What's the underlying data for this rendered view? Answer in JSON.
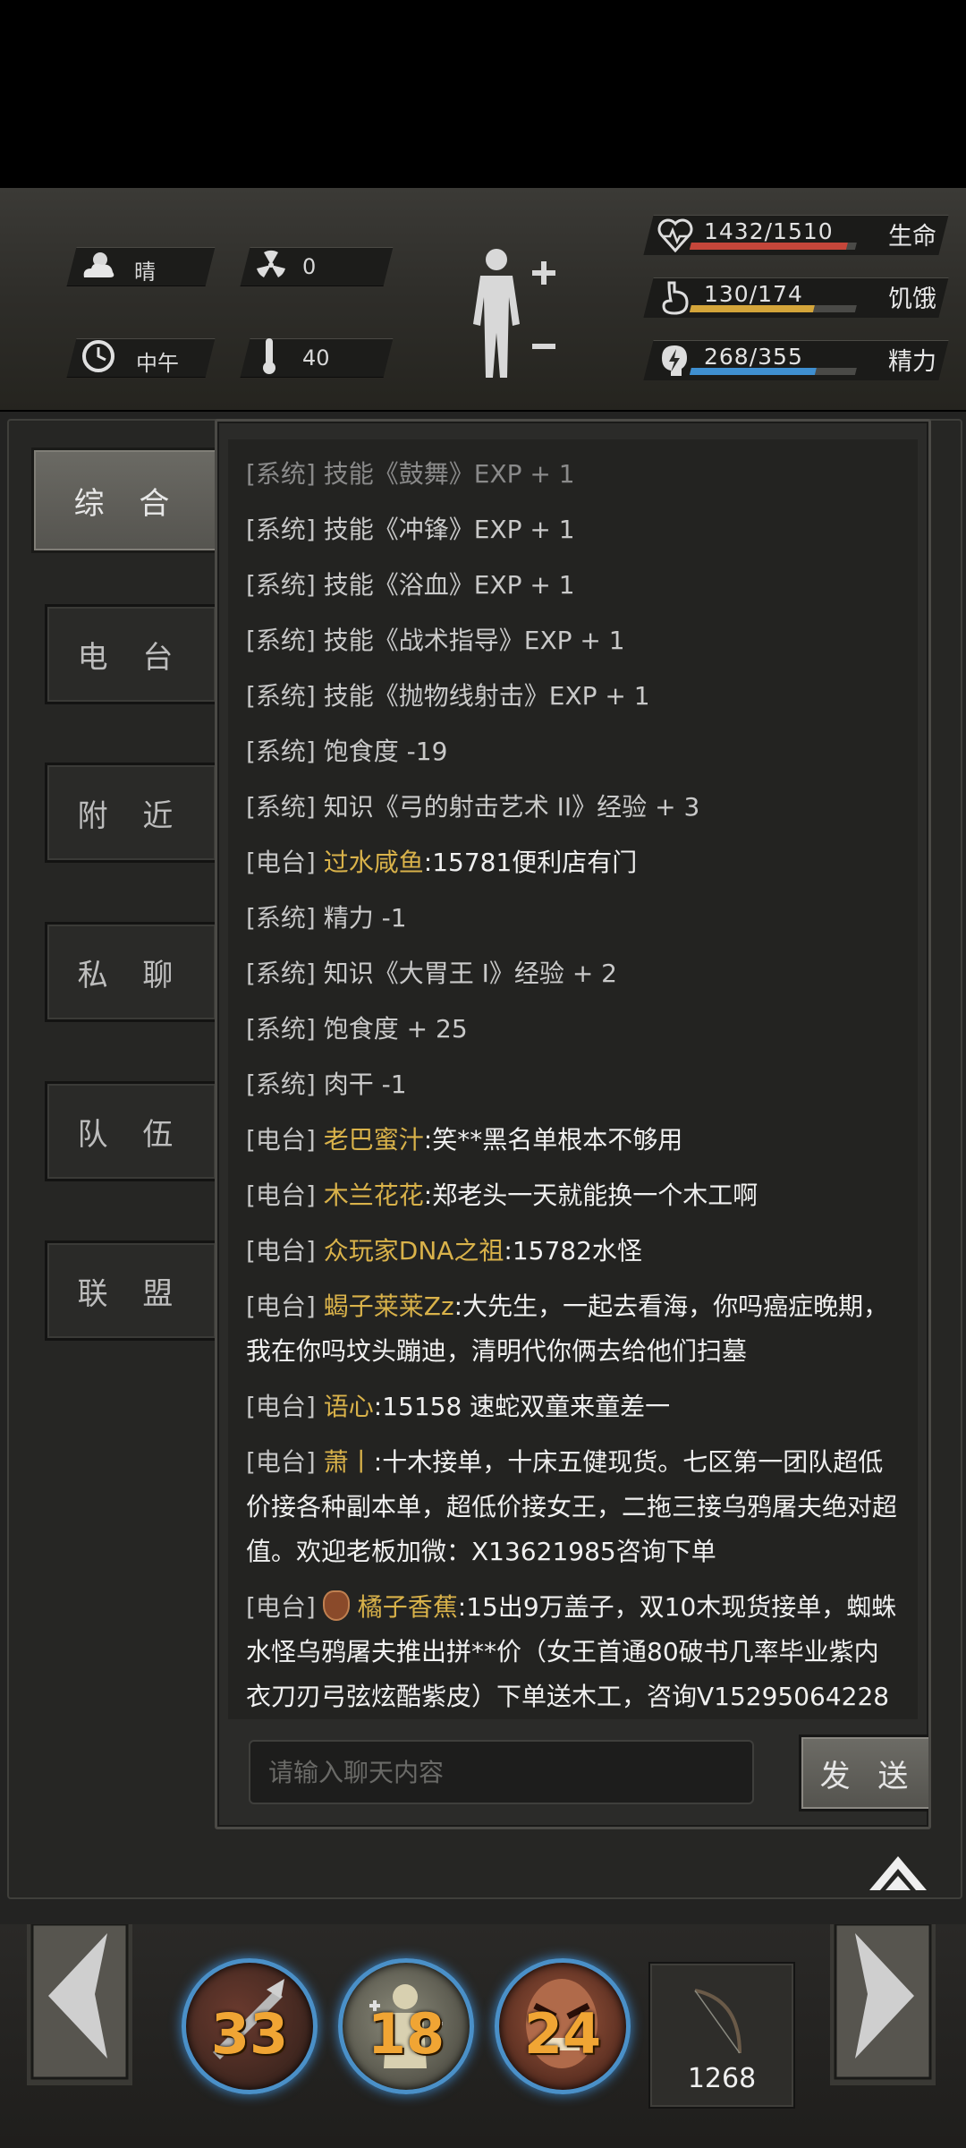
{
  "status": {
    "weather": "晴",
    "radiation": "0",
    "time_of_day": "中午",
    "temperature": "40",
    "health": {
      "value": "1432/1510",
      "label": "生命",
      "fraction": 0.948,
      "color": "#c5463a"
    },
    "hunger": {
      "value": "130/174",
      "label": "饥饿",
      "fraction": 0.747,
      "color": "#d4a53a"
    },
    "energy": {
      "value": "268/355",
      "label": "精力",
      "fraction": 0.755,
      "color": "#3f8fd0"
    }
  },
  "tabs": [
    "综 合",
    "电 台",
    "附 近",
    "私 聊",
    "队 伍",
    "联 盟"
  ],
  "chat": {
    "truncated_top": "[系统] 技能《鼓舞》EXP + 1",
    "lines": [
      {
        "ch": "[系统]",
        "name": "",
        "msg": " 技能《冲锋》EXP + 1"
      },
      {
        "ch": "[系统]",
        "name": "",
        "msg": " 技能《浴血》EXP + 1"
      },
      {
        "ch": "[系统]",
        "name": "",
        "msg": " 技能《战术指导》EXP + 1"
      },
      {
        "ch": "[系统]",
        "name": "",
        "msg": " 技能《抛物线射击》EXP + 1"
      },
      {
        "ch": "[系统]",
        "name": "",
        "msg": " 饱食度 -19"
      },
      {
        "ch": "[系统]",
        "name": "",
        "msg": " 知识《弓的射击艺术 II》经验 + 3"
      },
      {
        "ch": "[电台]",
        "name": " 过水咸鱼",
        "msg": ":15781便利店有门"
      },
      {
        "ch": "[系统]",
        "name": "",
        "msg": " 精力 -1"
      },
      {
        "ch": "[系统]",
        "name": "",
        "msg": " 知识《大胃王 I》经验 + 2"
      },
      {
        "ch": "[系统]",
        "name": "",
        "msg": " 饱食度 + 25"
      },
      {
        "ch": "[系统]",
        "name": "",
        "msg": " 肉干 -1"
      },
      {
        "ch": "[电台]",
        "name": " 老巴蜜汁",
        "msg": ":笑**黑名单根本不够用"
      },
      {
        "ch": "[电台]",
        "name": " 木兰花花",
        "msg": ":郑老头一天就能换一个木工啊"
      },
      {
        "ch": "[电台]",
        "name": " 众玩家DNA之祖",
        "msg": ":15782水怪"
      },
      {
        "ch": "[电台]",
        "name": " 蝎子莱莱Zz",
        "msg": ":大先生，一起去看海，你吗癌症晚期，我在你吗坟头蹦迪，清明代你俩去给他们扫墓"
      },
      {
        "ch": "[电台]",
        "name": " 语心",
        "msg": ":15158 速蛇双童来童差一"
      },
      {
        "ch": "[电台]",
        "name": " 萧丨",
        "msg": ":十木接单，十床五健现货。七区第一团队超低价接各种副本单，超低价接女王，二拖三接乌鸦屠夫绝对超值。欢迎老板加微：X13621985咨询下单"
      },
      {
        "ch": "[电台]",
        "name": " 橘子香蕉",
        "msg": ":15出9万盖子，双10木现货接单，蜘蛛水怪乌鸦屠夫推出拼**价（女王首通80破书几率毕业紫内衣刀刃弓弦炫酷紫皮）下单送木工，咨询V15295064228",
        "badge": true
      }
    ],
    "input_placeholder": "请输入聊天内容",
    "send_label": "发 送"
  },
  "bottom": {
    "skills": [
      "33",
      "18",
      "24"
    ],
    "item_count": "1268"
  }
}
